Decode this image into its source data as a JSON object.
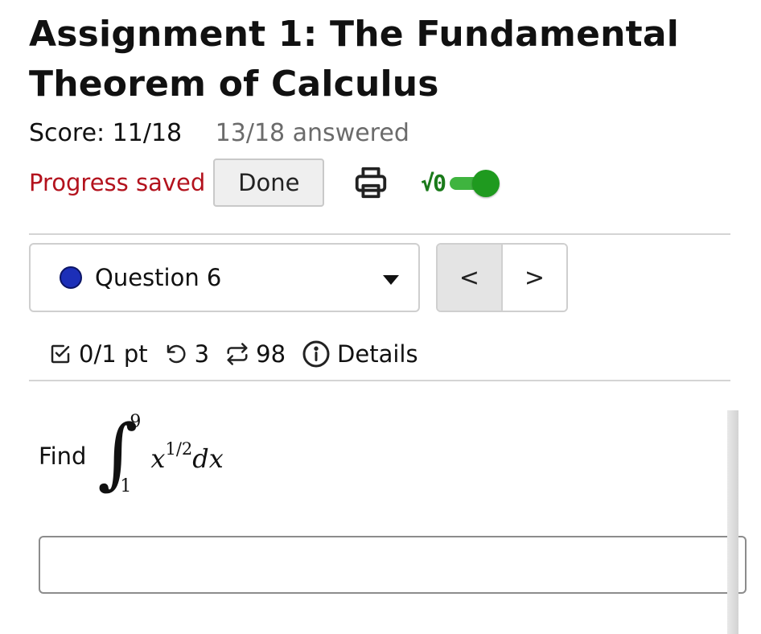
{
  "header": {
    "title": "Assignment 1: The Fundamental Theorem of Calculus",
    "score": "Score: 11/18",
    "answered": "13/18 answered"
  },
  "status": {
    "saved_text": "Progress saved",
    "done_label": "Done",
    "math_toggle_label": "√0",
    "math_toggle_on": true
  },
  "question_nav": {
    "selected": "Question 6",
    "prev_label": "<",
    "next_label": ">"
  },
  "meta": {
    "points": "0/1 pt",
    "attempts": "3",
    "versions": "98",
    "details_label": "Details"
  },
  "question": {
    "prompt_word": "Find",
    "lower_limit": "1",
    "upper_limit": "9",
    "integrand_base": "x",
    "integrand_exponent": "1/2",
    "differential": "dx"
  },
  "answer": {
    "value": ""
  },
  "colors": {
    "saved": "#b3121d",
    "toggle_on": "#1f9a1f",
    "question_dot": "#1c2fb8"
  },
  "icons": {
    "print": "printer-icon",
    "points": "checkbox-icon",
    "attempts": "undo-icon",
    "versions": "repeat-icon",
    "details": "info-icon"
  }
}
